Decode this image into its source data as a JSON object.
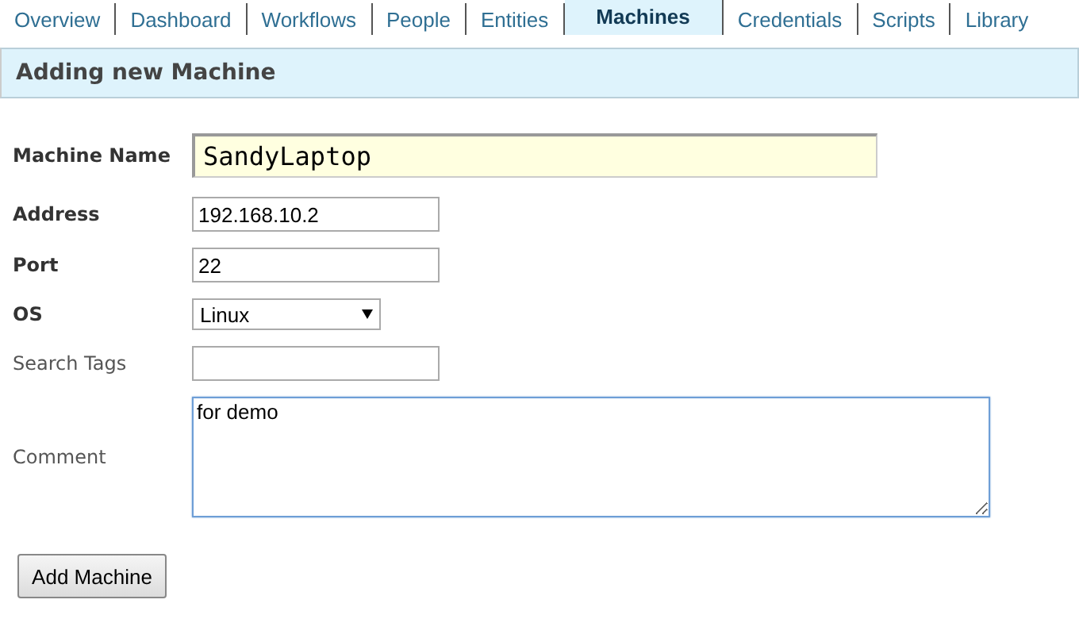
{
  "tabs": [
    {
      "label": "Overview",
      "selected": false
    },
    {
      "label": "Dashboard",
      "selected": false
    },
    {
      "label": "Workflows",
      "selected": false
    },
    {
      "label": "People",
      "selected": false
    },
    {
      "label": "Entities",
      "selected": false
    },
    {
      "label": "Machines",
      "selected": true
    },
    {
      "label": "Credentials",
      "selected": false
    },
    {
      "label": "Scripts",
      "selected": false
    },
    {
      "label": "Library",
      "selected": false
    }
  ],
  "panel": {
    "title": "Adding new Machine"
  },
  "fields": [
    {
      "label": "Machine Name",
      "required": true,
      "kind": "name",
      "value": "SandyLaptop"
    },
    {
      "label": "Address",
      "required": true,
      "kind": "text",
      "value": "192.168.10.2"
    },
    {
      "label": "Port",
      "required": true,
      "kind": "text",
      "value": "22"
    },
    {
      "label": "OS",
      "required": true,
      "kind": "select",
      "value": "Linux"
    },
    {
      "label": "Search Tags",
      "required": false,
      "kind": "text"
    },
    {
      "label": "Comment",
      "required": false,
      "kind": "textarea",
      "value": "for demo"
    }
  ],
  "buttons": [
    "Add Machine"
  ]
}
